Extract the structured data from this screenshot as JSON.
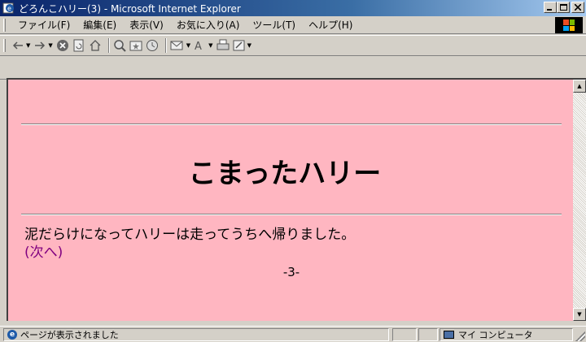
{
  "window": {
    "title": "どろんこハリー(3) - Microsoft Internet Explorer"
  },
  "menubar": {
    "items": [
      "ファイル(F)",
      "編集(E)",
      "表示(V)",
      "お気に入り(A)",
      "ツール(T)",
      "ヘルプ(H)"
    ]
  },
  "toolbar": {
    "buttons": [
      "back-icon",
      "forward-icon",
      "stop-icon",
      "refresh-icon",
      "home-icon",
      "search-icon",
      "favorites-icon",
      "history-icon",
      "mail-icon",
      "font-size-icon",
      "print-icon",
      "edit-icon"
    ]
  },
  "page": {
    "headline": "こまったハリー",
    "body_text": "泥だらけになってハリーは走ってうちへ帰りました。",
    "next_link": "(次へ)",
    "page_number": "-3-",
    "background_color": "#ffb6c1",
    "link_color": "#800080"
  },
  "status": {
    "text": "ページが表示されました",
    "zone": "マイ コンピュータ"
  }
}
